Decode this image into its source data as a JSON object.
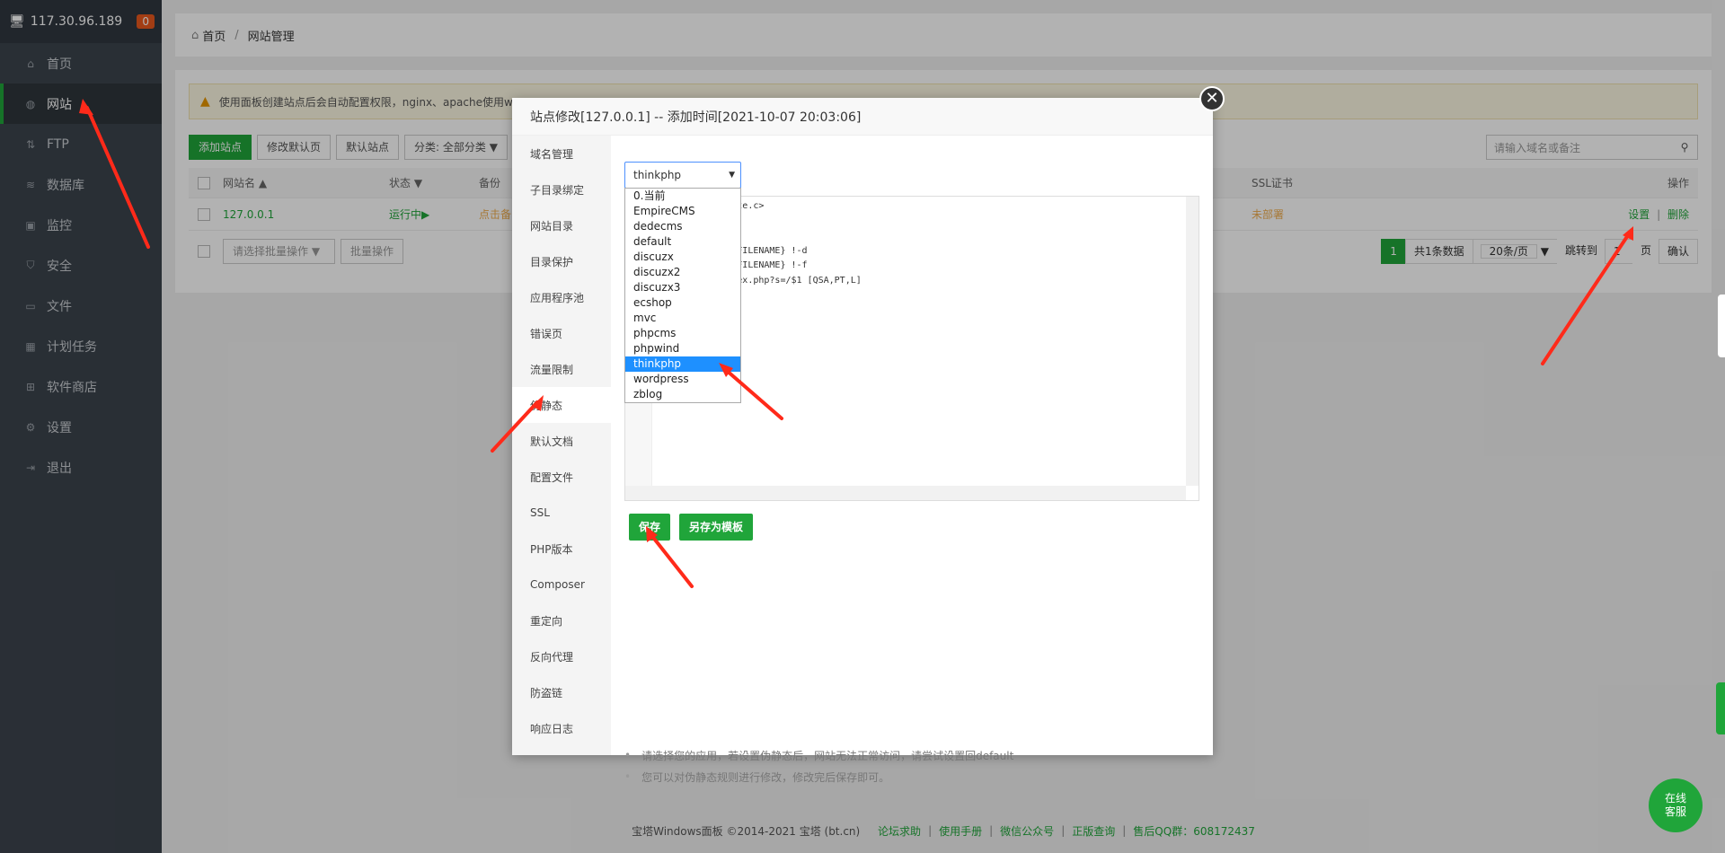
{
  "sidebar": {
    "server_ip": "117.30.96.189",
    "badge": "0",
    "items": [
      {
        "label": "首页",
        "icon": "home-icon"
      },
      {
        "label": "网站",
        "icon": "globe-icon",
        "active": true
      },
      {
        "label": "FTP",
        "icon": "ftp-icon"
      },
      {
        "label": "数据库",
        "icon": "database-icon"
      },
      {
        "label": "监控",
        "icon": "monitor-icon"
      },
      {
        "label": "安全",
        "icon": "shield-icon"
      },
      {
        "label": "文件",
        "icon": "folder-icon"
      },
      {
        "label": "计划任务",
        "icon": "calendar-icon"
      },
      {
        "label": "软件商店",
        "icon": "store-icon"
      },
      {
        "label": "设置",
        "icon": "gear-icon"
      },
      {
        "label": "退出",
        "icon": "logout-icon"
      }
    ]
  },
  "breadcrumb": {
    "home": "首页",
    "sep": "/",
    "current": "网站管理"
  },
  "notice": "使用面板创建站点后会自动配置权限，nginx、apache使用w",
  "toolbar": {
    "add_site": "添加站点",
    "modify_default": "修改默认页",
    "default_site": "默认站点",
    "category": "分类: 全部分类",
    "search_placeholder": "请输入域名或备注"
  },
  "table": {
    "headers": {
      "name": "网站名 ▲",
      "status": "状态 ▼",
      "backup": "备份",
      "ssl": "SSL证书",
      "ops": "操作"
    },
    "row": {
      "name": "127.0.0.1",
      "status": "运行中▶",
      "backup": "点击备",
      "ssl": "未部署",
      "setting": "设置",
      "sep": "|",
      "delete": "删除"
    }
  },
  "table_footer": {
    "batch_select": "请选择批量操作",
    "batch_btn": "批量操作",
    "page": "1",
    "total": "共1条数据",
    "per_page": "20条/页",
    "goto": "跳转到",
    "goto_value": "1",
    "page_unit": "页",
    "confirm": "确认"
  },
  "modal": {
    "title": "站点修改[127.0.0.1] -- 添加时间[2021-10-07 20:03:06]",
    "close": "✕",
    "nav": [
      "域名管理",
      "子目录绑定",
      "网站目录",
      "目录保护",
      "应用程序池",
      "错误页",
      "流量限制",
      "伪静态",
      "默认文档",
      "配置文件",
      "SSL",
      "PHP版本",
      "Composer",
      "重定向",
      "反向代理",
      "防盗链",
      "响应日志"
    ],
    "active_nav": "伪静态",
    "select_value": "thinkphp",
    "options": [
      "0.当前",
      "EmpireCMS",
      "dedecms",
      "default",
      "discuzx",
      "discuzx2",
      "discuzx3",
      "ecshop",
      "mvc",
      "phpcms",
      "phpwind",
      "thinkphp",
      "wordpress",
      "zblog"
    ],
    "selected_option": "thinkphp",
    "code_lines": [
      "           write.c>",
      "           n",
      "",
      "       EQUEST_FILENAME} !-d",
      "       EQUEST_FILENAME} !-f",
      "       *)$ index.php?s=/$1 [QSA,PT,L]"
    ],
    "save": "保存",
    "save_template": "另存为模板",
    "tips": [
      "请选择您的应用，若设置伪静态后，网站无法正常访问，请尝试设置回default",
      "您可以对伪静态规则进行修改，修改完后保存即可。"
    ]
  },
  "footer": {
    "copyright": "宝塔Windows面板 ©2014-2021 宝塔 (bt.cn)",
    "links": [
      "论坛求助",
      "使用手册",
      "微信公众号",
      "正版查询"
    ],
    "qq": "售后QQ群：608172437"
  },
  "chat": "在线\n客服",
  "colors": {
    "accent": "#20a53a",
    "sidebar": "#3c444d",
    "arrow": "#ff2a1a"
  }
}
